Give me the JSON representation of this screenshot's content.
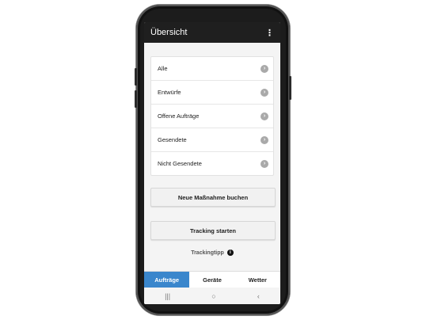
{
  "appbar": {
    "title": "Übersicht",
    "menu_icon": "⋮"
  },
  "list": {
    "items": [
      {
        "label": "Alle"
      },
      {
        "label": "Entwürfe"
      },
      {
        "label": "Offene Aufträge"
      },
      {
        "label": "Gesendete"
      },
      {
        "label": "Nicht Gesendete"
      }
    ],
    "chevron": "›"
  },
  "actions": {
    "new_measure": "Neue Maßnahme buchen",
    "tracking_start": "Tracking starten"
  },
  "tip": {
    "label": "Trackingtipp",
    "icon": "i"
  },
  "tabs": [
    {
      "label": "Aufträge",
      "active": true
    },
    {
      "label": "Geräte",
      "active": false
    },
    {
      "label": "Wetter",
      "active": false
    }
  ],
  "navbar": {
    "recents": "|||",
    "home": "○",
    "back": "‹"
  },
  "colors": {
    "accent": "#3a86cc",
    "appbar": "#1f1f1f"
  }
}
